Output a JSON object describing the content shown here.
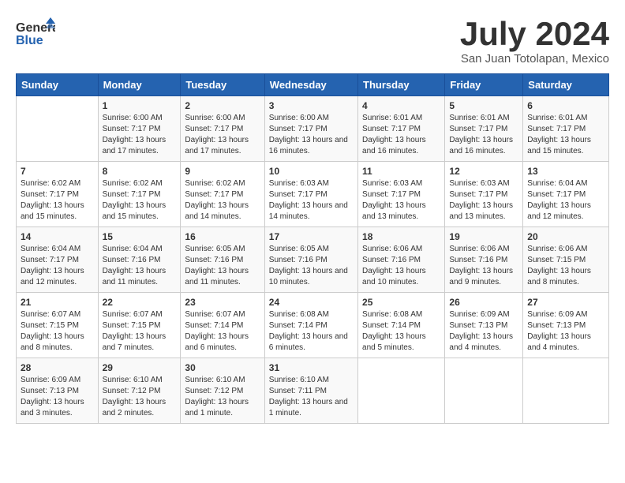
{
  "logo": {
    "general": "General",
    "blue": "Blue"
  },
  "title": "July 2024",
  "location": "San Juan Totolapan, Mexico",
  "days_of_week": [
    "Sunday",
    "Monday",
    "Tuesday",
    "Wednesday",
    "Thursday",
    "Friday",
    "Saturday"
  ],
  "weeks": [
    [
      {
        "num": "",
        "sunrise": "",
        "sunset": "",
        "daylight": ""
      },
      {
        "num": "1",
        "sunrise": "Sunrise: 6:00 AM",
        "sunset": "Sunset: 7:17 PM",
        "daylight": "Daylight: 13 hours and 17 minutes."
      },
      {
        "num": "2",
        "sunrise": "Sunrise: 6:00 AM",
        "sunset": "Sunset: 7:17 PM",
        "daylight": "Daylight: 13 hours and 17 minutes."
      },
      {
        "num": "3",
        "sunrise": "Sunrise: 6:00 AM",
        "sunset": "Sunset: 7:17 PM",
        "daylight": "Daylight: 13 hours and 16 minutes."
      },
      {
        "num": "4",
        "sunrise": "Sunrise: 6:01 AM",
        "sunset": "Sunset: 7:17 PM",
        "daylight": "Daylight: 13 hours and 16 minutes."
      },
      {
        "num": "5",
        "sunrise": "Sunrise: 6:01 AM",
        "sunset": "Sunset: 7:17 PM",
        "daylight": "Daylight: 13 hours and 16 minutes."
      },
      {
        "num": "6",
        "sunrise": "Sunrise: 6:01 AM",
        "sunset": "Sunset: 7:17 PM",
        "daylight": "Daylight: 13 hours and 15 minutes."
      }
    ],
    [
      {
        "num": "7",
        "sunrise": "Sunrise: 6:02 AM",
        "sunset": "Sunset: 7:17 PM",
        "daylight": "Daylight: 13 hours and 15 minutes."
      },
      {
        "num": "8",
        "sunrise": "Sunrise: 6:02 AM",
        "sunset": "Sunset: 7:17 PM",
        "daylight": "Daylight: 13 hours and 15 minutes."
      },
      {
        "num": "9",
        "sunrise": "Sunrise: 6:02 AM",
        "sunset": "Sunset: 7:17 PM",
        "daylight": "Daylight: 13 hours and 14 minutes."
      },
      {
        "num": "10",
        "sunrise": "Sunrise: 6:03 AM",
        "sunset": "Sunset: 7:17 PM",
        "daylight": "Daylight: 13 hours and 14 minutes."
      },
      {
        "num": "11",
        "sunrise": "Sunrise: 6:03 AM",
        "sunset": "Sunset: 7:17 PM",
        "daylight": "Daylight: 13 hours and 13 minutes."
      },
      {
        "num": "12",
        "sunrise": "Sunrise: 6:03 AM",
        "sunset": "Sunset: 7:17 PM",
        "daylight": "Daylight: 13 hours and 13 minutes."
      },
      {
        "num": "13",
        "sunrise": "Sunrise: 6:04 AM",
        "sunset": "Sunset: 7:17 PM",
        "daylight": "Daylight: 13 hours and 12 minutes."
      }
    ],
    [
      {
        "num": "14",
        "sunrise": "Sunrise: 6:04 AM",
        "sunset": "Sunset: 7:17 PM",
        "daylight": "Daylight: 13 hours and 12 minutes."
      },
      {
        "num": "15",
        "sunrise": "Sunrise: 6:04 AM",
        "sunset": "Sunset: 7:16 PM",
        "daylight": "Daylight: 13 hours and 11 minutes."
      },
      {
        "num": "16",
        "sunrise": "Sunrise: 6:05 AM",
        "sunset": "Sunset: 7:16 PM",
        "daylight": "Daylight: 13 hours and 11 minutes."
      },
      {
        "num": "17",
        "sunrise": "Sunrise: 6:05 AM",
        "sunset": "Sunset: 7:16 PM",
        "daylight": "Daylight: 13 hours and 10 minutes."
      },
      {
        "num": "18",
        "sunrise": "Sunrise: 6:06 AM",
        "sunset": "Sunset: 7:16 PM",
        "daylight": "Daylight: 13 hours and 10 minutes."
      },
      {
        "num": "19",
        "sunrise": "Sunrise: 6:06 AM",
        "sunset": "Sunset: 7:16 PM",
        "daylight": "Daylight: 13 hours and 9 minutes."
      },
      {
        "num": "20",
        "sunrise": "Sunrise: 6:06 AM",
        "sunset": "Sunset: 7:15 PM",
        "daylight": "Daylight: 13 hours and 8 minutes."
      }
    ],
    [
      {
        "num": "21",
        "sunrise": "Sunrise: 6:07 AM",
        "sunset": "Sunset: 7:15 PM",
        "daylight": "Daylight: 13 hours and 8 minutes."
      },
      {
        "num": "22",
        "sunrise": "Sunrise: 6:07 AM",
        "sunset": "Sunset: 7:15 PM",
        "daylight": "Daylight: 13 hours and 7 minutes."
      },
      {
        "num": "23",
        "sunrise": "Sunrise: 6:07 AM",
        "sunset": "Sunset: 7:14 PM",
        "daylight": "Daylight: 13 hours and 6 minutes."
      },
      {
        "num": "24",
        "sunrise": "Sunrise: 6:08 AM",
        "sunset": "Sunset: 7:14 PM",
        "daylight": "Daylight: 13 hours and 6 minutes."
      },
      {
        "num": "25",
        "sunrise": "Sunrise: 6:08 AM",
        "sunset": "Sunset: 7:14 PM",
        "daylight": "Daylight: 13 hours and 5 minutes."
      },
      {
        "num": "26",
        "sunrise": "Sunrise: 6:09 AM",
        "sunset": "Sunset: 7:13 PM",
        "daylight": "Daylight: 13 hours and 4 minutes."
      },
      {
        "num": "27",
        "sunrise": "Sunrise: 6:09 AM",
        "sunset": "Sunset: 7:13 PM",
        "daylight": "Daylight: 13 hours and 4 minutes."
      }
    ],
    [
      {
        "num": "28",
        "sunrise": "Sunrise: 6:09 AM",
        "sunset": "Sunset: 7:13 PM",
        "daylight": "Daylight: 13 hours and 3 minutes."
      },
      {
        "num": "29",
        "sunrise": "Sunrise: 6:10 AM",
        "sunset": "Sunset: 7:12 PM",
        "daylight": "Daylight: 13 hours and 2 minutes."
      },
      {
        "num": "30",
        "sunrise": "Sunrise: 6:10 AM",
        "sunset": "Sunset: 7:12 PM",
        "daylight": "Daylight: 13 hours and 1 minute."
      },
      {
        "num": "31",
        "sunrise": "Sunrise: 6:10 AM",
        "sunset": "Sunset: 7:11 PM",
        "daylight": "Daylight: 13 hours and 1 minute."
      },
      {
        "num": "",
        "sunrise": "",
        "sunset": "",
        "daylight": ""
      },
      {
        "num": "",
        "sunrise": "",
        "sunset": "",
        "daylight": ""
      },
      {
        "num": "",
        "sunrise": "",
        "sunset": "",
        "daylight": ""
      }
    ]
  ]
}
